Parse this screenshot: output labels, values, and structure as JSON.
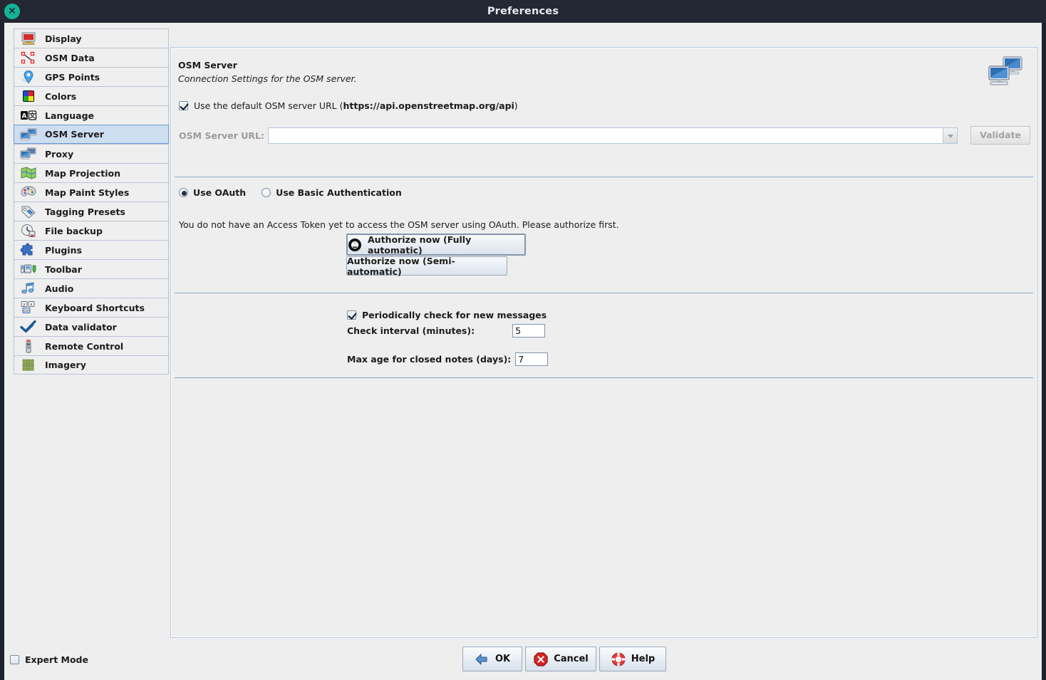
{
  "window": {
    "title": "Preferences",
    "close_icon": "close-circle-icon"
  },
  "sidebar": {
    "items": [
      {
        "label": "Display",
        "icon": "display-icon",
        "selected": false
      },
      {
        "label": "OSM Data",
        "icon": "osm-data-icon",
        "selected": false
      },
      {
        "label": "GPS Points",
        "icon": "gps-points-icon",
        "selected": false
      },
      {
        "label": "Colors",
        "icon": "colors-icon",
        "selected": false
      },
      {
        "label": "Language",
        "icon": "language-icon",
        "selected": false
      },
      {
        "label": "OSM Server",
        "icon": "osm-server-icon",
        "selected": true
      },
      {
        "label": "Proxy",
        "icon": "proxy-icon",
        "selected": false
      },
      {
        "label": "Map Projection",
        "icon": "map-projection-icon",
        "selected": false
      },
      {
        "label": "Map Paint Styles",
        "icon": "map-paint-styles-icon",
        "selected": false
      },
      {
        "label": "Tagging Presets",
        "icon": "tagging-presets-icon",
        "selected": false
      },
      {
        "label": "File backup",
        "icon": "file-backup-icon",
        "selected": false
      },
      {
        "label": "Plugins",
        "icon": "plugins-icon",
        "selected": false
      },
      {
        "label": "Toolbar",
        "icon": "toolbar-icon",
        "selected": false
      },
      {
        "label": "Audio",
        "icon": "audio-icon",
        "selected": false
      },
      {
        "label": "Keyboard Shortcuts",
        "icon": "keyboard-shortcuts-icon",
        "selected": false
      },
      {
        "label": "Data validator",
        "icon": "data-validator-icon",
        "selected": false
      },
      {
        "label": "Remote Control",
        "icon": "remote-control-icon",
        "selected": false
      },
      {
        "label": "Imagery",
        "icon": "imagery-icon",
        "selected": false
      }
    ]
  },
  "panel": {
    "title": "OSM Server",
    "subtitle": "Connection Settings for the OSM server.",
    "header_icon": "osm-server-icon",
    "default_url": {
      "label_before": "Use the default OSM server URL (",
      "label_bold": "https://api.openstreetmap.org/api",
      "label_after": ")",
      "checked": true
    },
    "url_field": {
      "label": "OSM Server URL:",
      "value": "",
      "placeholder": "",
      "enabled": false,
      "dropdown_icon": "chevron-down-icon"
    },
    "validate_button": {
      "label": "Validate",
      "enabled": false
    },
    "auth_mode": {
      "oauth_label": "Use OAuth",
      "basic_label": "Use Basic Authentication",
      "selected": "oauth"
    },
    "oauth_note": "You do not have an Access Token yet to access the OSM server using OAuth. Please authorize first.",
    "authorize_auto_button": {
      "label": "Authorize now (Fully automatic)",
      "icon": "oauth-icon"
    },
    "authorize_semi_button": {
      "label": "Authorize now (Semi-automatic)"
    },
    "messages": {
      "periodic_check": {
        "label": "Periodically check for new messages",
        "checked": true
      },
      "check_interval": {
        "label": "Check interval (minutes):",
        "value": "5"
      },
      "max_age": {
        "label": "Max age for closed notes (days):",
        "value": "7"
      }
    }
  },
  "footer": {
    "expert_mode": {
      "label": "Expert Mode",
      "checked": false
    },
    "ok_button": {
      "label": "OK",
      "icon": "apply-arrow-icon"
    },
    "cancel_button": {
      "label": "Cancel",
      "icon": "cancel-octagon-icon"
    },
    "help_button": {
      "label": "Help",
      "icon": "lifebuoy-icon"
    }
  },
  "colors": {
    "titlebar_bg": "#242834",
    "dialog_bg": "#eeeeee",
    "selection_bg": "#cddef1",
    "selection_border": "#6f9bd0",
    "separator": "#8da8c6",
    "close_button": "#14b397",
    "disabled_text": "#a3a3a3"
  }
}
